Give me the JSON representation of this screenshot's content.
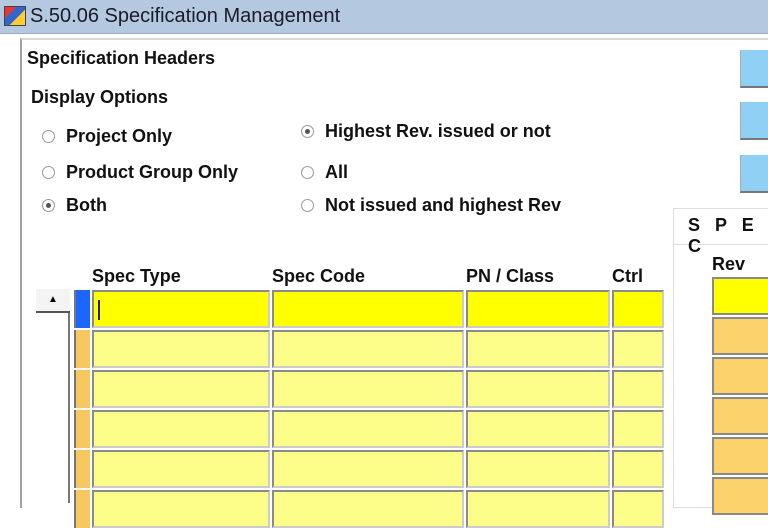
{
  "window": {
    "title": "S.50.06 Specification Management",
    "icon": "app-icon"
  },
  "section_title": "Specification Headers",
  "display_options": {
    "label": "Display Options",
    "scope": [
      {
        "label": "Project Only",
        "selected": false
      },
      {
        "label": "Product Group Only",
        "selected": false
      },
      {
        "label": "Both",
        "selected": true
      }
    ],
    "revision": [
      {
        "label": "Highest Rev. issued or not",
        "selected": true
      },
      {
        "label": "All",
        "selected": false
      },
      {
        "label": "Not issued and highest Rev",
        "selected": false
      }
    ]
  },
  "grid": {
    "columns": [
      "Spec Type",
      "Spec Code",
      "PN / Class",
      "Ctrl"
    ],
    "rows": [
      [
        "",
        "",
        "",
        ""
      ],
      [
        "",
        "",
        "",
        ""
      ],
      [
        "",
        "",
        "",
        ""
      ],
      [
        "",
        "",
        "",
        ""
      ],
      [
        "",
        "",
        "",
        ""
      ],
      [
        "",
        "",
        "",
        ""
      ]
    ]
  },
  "spec_panel": {
    "title": "S P E C",
    "column": "Rev"
  },
  "colors": {
    "current_row": "#ffff00",
    "row": "#fdfd8a",
    "indicator_current": "#1a66ff",
    "indicator": "#f8c860",
    "button": "#8fd0f4",
    "title_bar": "#b4c8e0"
  }
}
